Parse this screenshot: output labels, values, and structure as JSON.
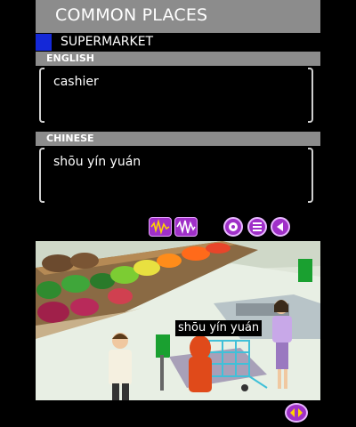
{
  "header": {
    "title": "COMMON PLACES"
  },
  "category": {
    "label": "SUPERMARKET",
    "accent_color": "#1428d8"
  },
  "english": {
    "header": "ENGLISH",
    "text": "cashier"
  },
  "chinese": {
    "header": "CHINESE",
    "text": "shōu yín yuán"
  },
  "toolbar": {
    "buttons": [
      {
        "icon": "audio-wave-icon"
      },
      {
        "icon": "record-wave-icon"
      },
      {
        "icon": "settings-icon"
      },
      {
        "icon": "menu-icon"
      },
      {
        "icon": "back-icon"
      }
    ],
    "accent_color": "#a030c8"
  },
  "scene": {
    "caption": "shōu yín yuán"
  },
  "footer": {
    "button_icon": "prev-next-icon"
  }
}
